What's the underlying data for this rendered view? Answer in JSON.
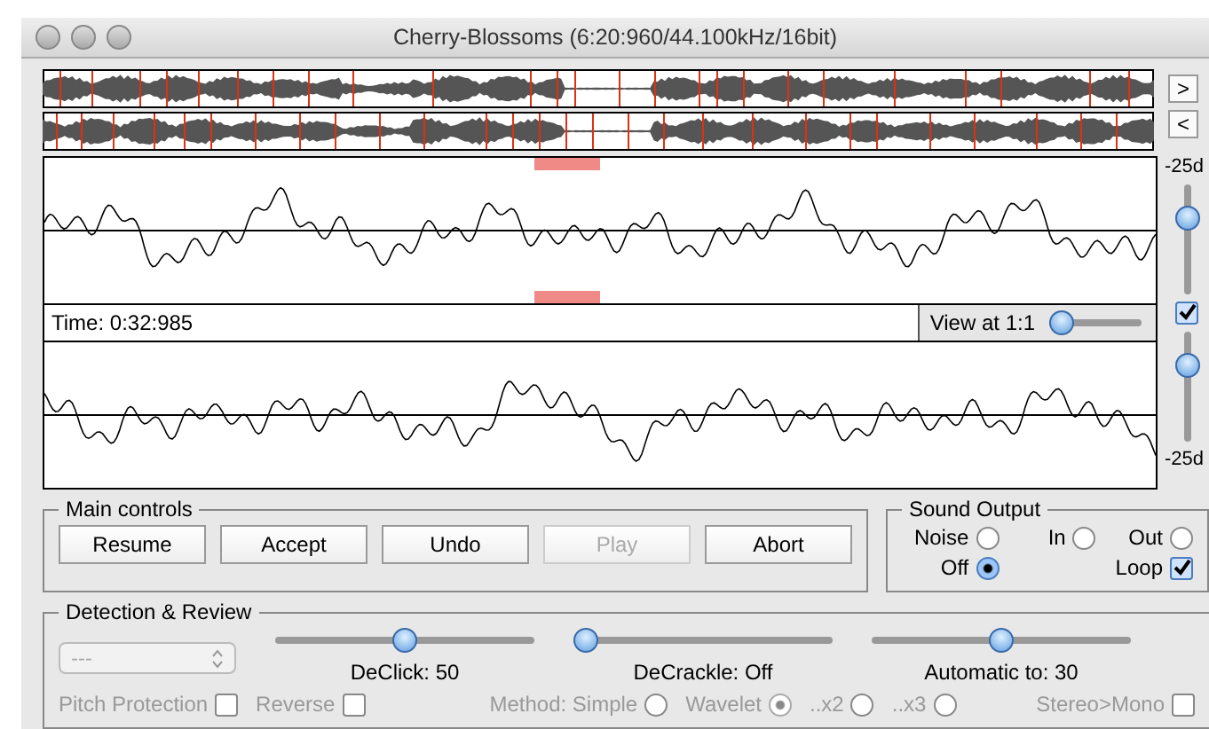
{
  "window": {
    "title": "Cherry-Blossoms (6:20:960/44.100kHz/16bit)"
  },
  "overview_nav": [
    {
      "label": ">"
    },
    {
      "label": "<"
    }
  ],
  "time_readout": "Time: 0:32:985",
  "view_zoom": {
    "label": "View at 1:1",
    "level": 0.0
  },
  "channel_gain": {
    "top_label": "-25d",
    "bottom_label": "-25d",
    "sliders": [
      {
        "level": 0.75
      },
      {
        "level": 0.75
      }
    ],
    "link_checked": true
  },
  "main_controls": {
    "title": "Main controls",
    "buttons": [
      {
        "label": "Resume",
        "disabled": false
      },
      {
        "label": "Accept",
        "disabled": false
      },
      {
        "label": "Undo",
        "disabled": false
      },
      {
        "label": "Play",
        "disabled": true
      },
      {
        "label": "Abort",
        "disabled": false
      }
    ]
  },
  "sound_output": {
    "title": "Sound Output",
    "options": [
      {
        "label": "Noise",
        "kind": "radio",
        "selected": false
      },
      {
        "label": "In",
        "kind": "radio",
        "selected": false
      },
      {
        "label": "Out",
        "kind": "radio",
        "selected": false
      },
      {
        "label": "Off",
        "kind": "radio",
        "selected": true
      },
      {
        "label": "Loop",
        "kind": "checkbox",
        "checked": true
      }
    ]
  },
  "detection": {
    "title": "Detection & Review",
    "dropdown": {
      "value": "---",
      "disabled": true
    },
    "sliders": [
      {
        "label": "DeClick: 50",
        "level": 0.5
      },
      {
        "label": "DeCrackle: Off",
        "level": 0.0
      },
      {
        "label": "Automatic to: 30",
        "level": 0.5
      }
    ],
    "options": [
      {
        "label": "Pitch Protection",
        "kind": "checkbox",
        "checked": false,
        "disabled": true
      },
      {
        "label": "Reverse",
        "kind": "checkbox",
        "checked": false,
        "disabled": true
      },
      {
        "label": "Method: Simple",
        "kind": "radio",
        "selected": false,
        "disabled": true
      },
      {
        "label": "Wavelet",
        "kind": "radio",
        "selected": true,
        "disabled": true
      },
      {
        "label": "..x2",
        "kind": "radio",
        "selected": false,
        "disabled": true
      },
      {
        "label": "..x3",
        "kind": "radio",
        "selected": false,
        "disabled": true
      },
      {
        "label": "Stereo>Mono",
        "kind": "checkbox",
        "checked": false,
        "disabled": true
      }
    ]
  }
}
